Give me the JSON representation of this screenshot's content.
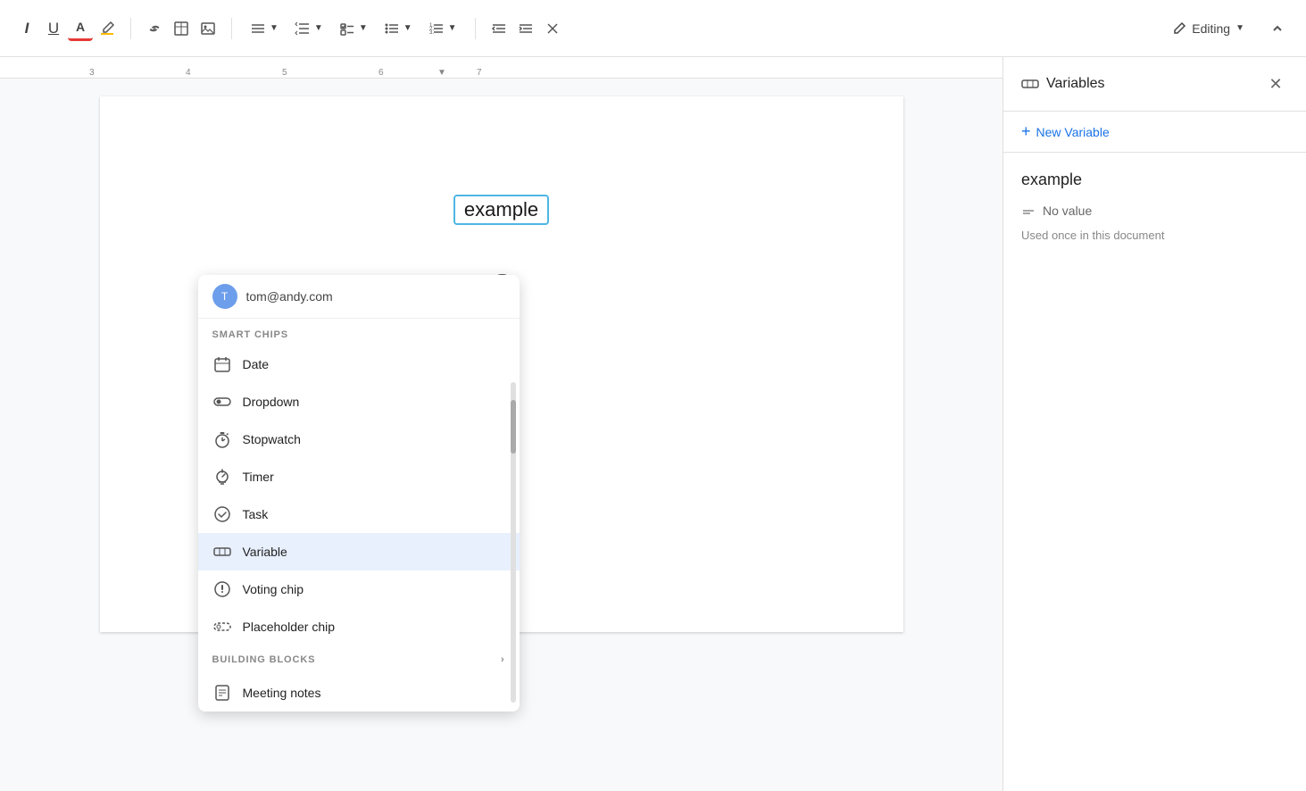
{
  "toolbar": {
    "italic_label": "I",
    "underline_label": "U",
    "font_color_label": "A",
    "highlight_label": "✏",
    "link_label": "🔗",
    "insert_image_label": "⊞",
    "photo_label": "🖼",
    "align_label": "≡",
    "indent_label": "≣",
    "list_label": "☰",
    "bullets_label": "•",
    "decrease_indent_label": "⇤",
    "increase_indent_label": "⇥",
    "clear_label": "✕",
    "editing_label": "Editing",
    "collapse_label": "⌃"
  },
  "ruler": {
    "marks": [
      "3",
      "4",
      "5",
      "6",
      "7"
    ]
  },
  "document": {
    "variable_chip_text": "example",
    "at_symbol": "@",
    "email_item": "tom@andy.com"
  },
  "smart_chips": {
    "section_label": "SMART CHIPS",
    "items": [
      {
        "id": "date",
        "label": "Date",
        "icon": "date-icon"
      },
      {
        "id": "dropdown",
        "label": "Dropdown",
        "icon": "dropdown-icon"
      },
      {
        "id": "stopwatch",
        "label": "Stopwatch",
        "icon": "stopwatch-icon"
      },
      {
        "id": "timer",
        "label": "Timer",
        "icon": "timer-icon"
      },
      {
        "id": "task",
        "label": "Task",
        "icon": "task-icon"
      },
      {
        "id": "variable",
        "label": "Variable",
        "icon": "variable-icon"
      },
      {
        "id": "voting-chip",
        "label": "Voting chip",
        "icon": "voting-icon"
      },
      {
        "id": "placeholder-chip",
        "label": "Placeholder chip",
        "icon": "placeholder-icon"
      }
    ],
    "building_blocks_label": "BUILDING BLOCKS",
    "meeting_notes_label": "Meeting notes"
  },
  "variables_sidebar": {
    "title": "Variables",
    "new_variable_label": "New Variable",
    "variable_name": "example",
    "variable_value_label": "No value",
    "variable_usage": "Used once in this document"
  }
}
